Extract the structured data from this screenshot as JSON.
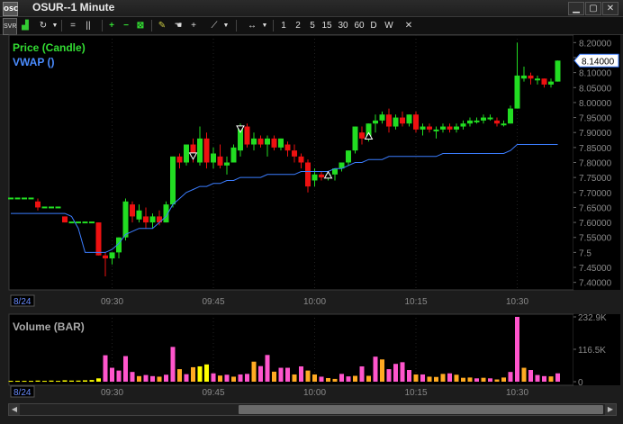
{
  "window": {
    "title": "OSUR--1 Minute",
    "app_icon_text": "OSC",
    "buttons": [
      "minimize-icon",
      "maximize-icon",
      "close-icon"
    ]
  },
  "toolbar": {
    "items": [
      "SVR",
      "chart-icon",
      "refresh-icon",
      "lines-icon",
      "pause-icon",
      "zoom-in-icon",
      "zoom-out-icon",
      "fit-icon",
      "draw-icon",
      "hand-icon",
      "crosshair-icon",
      "trendline-icon",
      "arrows-icon"
    ],
    "intervals": [
      "1",
      "2",
      "5",
      "15",
      "30",
      "60",
      "D",
      "W"
    ],
    "close_label": "✕"
  },
  "colors": {
    "up": "#22dd22",
    "down": "#ee1111",
    "vwap": "#3b7dff",
    "volume_pink": "#ff55cc",
    "volume_orange": "#ffaa22",
    "volume_yellow": "#ffff00",
    "grid": "#3a3a3a",
    "axis_text": "#8a8a8a"
  },
  "chart_data": [
    {
      "type": "candlestick",
      "title": "OSUR--1 Minute",
      "legend": [
        "Price (Candle)",
        "VWAP ()"
      ],
      "ylim": [
        7.375,
        8.225
      ],
      "y_ticks": [
        "8.20000",
        "8.15000",
        "8.10000",
        "8.05000",
        "8.00000",
        "7.95000",
        "7.90000",
        "7.85000",
        "7.80000",
        "7.75000",
        "7.70000",
        "7.65000",
        "7.60000",
        "7.55000",
        "7.5",
        "7.45000",
        "7.40000"
      ],
      "x_ticks": [
        "09:30",
        "09:45",
        "10:00",
        "10:15",
        "10:30"
      ],
      "date_label": "8/24",
      "last_price_label": "8.14000",
      "ohlc": [
        [
          7.68,
          7.68,
          7.67,
          7.68
        ],
        [
          7.68,
          7.68,
          7.67,
          7.68
        ],
        [
          7.68,
          7.68,
          7.67,
          7.68
        ],
        [
          7.68,
          7.68,
          7.67,
          7.68
        ],
        [
          7.67,
          7.68,
          7.64,
          7.65
        ],
        [
          7.65,
          7.66,
          7.64,
          7.65
        ],
        [
          7.65,
          7.65,
          7.64,
          7.65
        ],
        [
          7.65,
          7.65,
          7.64,
          7.65
        ],
        [
          7.62,
          7.62,
          7.6,
          7.6
        ],
        [
          7.6,
          7.62,
          7.59,
          7.6
        ],
        [
          7.6,
          7.6,
          7.59,
          7.6
        ],
        [
          7.6,
          7.61,
          7.59,
          7.6
        ],
        [
          7.6,
          7.6,
          7.59,
          7.6
        ],
        [
          7.6,
          7.6,
          7.49,
          7.49
        ],
        [
          7.49,
          7.5,
          7.42,
          7.48
        ],
        [
          7.48,
          7.5,
          7.46,
          7.5
        ],
        [
          7.5,
          7.55,
          7.48,
          7.55
        ],
        [
          7.55,
          7.68,
          7.54,
          7.67
        ],
        [
          7.66,
          7.67,
          7.6,
          7.62
        ],
        [
          7.61,
          7.66,
          7.6,
          7.64
        ],
        [
          7.62,
          7.65,
          7.58,
          7.6
        ],
        [
          7.6,
          7.63,
          7.58,
          7.62
        ],
        [
          7.62,
          7.64,
          7.59,
          7.6
        ],
        [
          7.6,
          7.67,
          7.6,
          7.66
        ],
        [
          7.66,
          7.82,
          7.65,
          7.82
        ],
        [
          7.82,
          7.83,
          7.78,
          7.8
        ],
        [
          7.8,
          7.86,
          7.79,
          7.86
        ],
        [
          7.86,
          7.88,
          7.8,
          7.82
        ],
        [
          7.8,
          7.92,
          7.79,
          7.88
        ],
        [
          7.88,
          7.9,
          7.78,
          7.8
        ],
        [
          7.8,
          7.85,
          7.78,
          7.83
        ],
        [
          7.82,
          7.86,
          7.78,
          7.79
        ],
        [
          7.79,
          7.82,
          7.76,
          7.8
        ],
        [
          7.8,
          7.86,
          7.8,
          7.85
        ],
        [
          7.84,
          7.93,
          7.82,
          7.92
        ],
        [
          7.92,
          7.93,
          7.85,
          7.86
        ],
        [
          7.86,
          7.9,
          7.84,
          7.88
        ],
        [
          7.88,
          7.89,
          7.85,
          7.86
        ],
        [
          7.86,
          7.89,
          7.82,
          7.88
        ],
        [
          7.88,
          7.89,
          7.84,
          7.85
        ],
        [
          7.85,
          7.88,
          7.84,
          7.88
        ],
        [
          7.86,
          7.87,
          7.82,
          7.84
        ],
        [
          7.84,
          7.86,
          7.8,
          7.82
        ],
        [
          7.82,
          7.83,
          7.78,
          7.8
        ],
        [
          7.8,
          7.81,
          7.7,
          7.72
        ],
        [
          7.74,
          7.78,
          7.72,
          7.76
        ],
        [
          7.76,
          7.77,
          7.74,
          7.75
        ],
        [
          7.75,
          7.77,
          7.74,
          7.76
        ],
        [
          7.76,
          7.78,
          7.74,
          7.78
        ],
        [
          7.78,
          7.8,
          7.77,
          7.8
        ],
        [
          7.8,
          7.84,
          7.79,
          7.84
        ],
        [
          7.84,
          7.92,
          7.83,
          7.92
        ],
        [
          7.9,
          7.92,
          7.86,
          7.88
        ],
        [
          7.88,
          7.93,
          7.87,
          7.93
        ],
        [
          7.93,
          7.96,
          7.9,
          7.94
        ],
        [
          7.94,
          7.97,
          7.93,
          7.96
        ],
        [
          7.96,
          7.98,
          7.9,
          7.92
        ],
        [
          7.92,
          7.96,
          7.91,
          7.95
        ],
        [
          7.95,
          7.97,
          7.92,
          7.93
        ],
        [
          7.93,
          7.96,
          7.92,
          7.96
        ],
        [
          7.96,
          7.97,
          7.9,
          7.91
        ],
        [
          7.91,
          7.93,
          7.89,
          7.92
        ],
        [
          7.92,
          7.93,
          7.9,
          7.91
        ],
        [
          7.91,
          7.92,
          7.88,
          7.91
        ],
        [
          7.91,
          7.93,
          7.9,
          7.92
        ],
        [
          7.92,
          7.93,
          7.9,
          7.91
        ],
        [
          7.91,
          7.93,
          7.9,
          7.92
        ],
        [
          7.92,
          7.94,
          7.91,
          7.93
        ],
        [
          7.93,
          7.95,
          7.92,
          7.94
        ],
        [
          7.94,
          7.95,
          7.93,
          7.94
        ],
        [
          7.94,
          7.96,
          7.93,
          7.95
        ],
        [
          7.95,
          7.96,
          7.94,
          7.95
        ],
        [
          7.94,
          7.95,
          7.92,
          7.93
        ],
        [
          7.93,
          7.94,
          7.92,
          7.93
        ],
        [
          7.93,
          7.99,
          7.93,
          7.98
        ],
        [
          7.98,
          8.2,
          7.98,
          8.09
        ],
        [
          8.08,
          8.12,
          8.07,
          8.09
        ],
        [
          8.09,
          8.1,
          8.06,
          8.08
        ],
        [
          8.08,
          8.09,
          8.06,
          8.08
        ],
        [
          8.08,
          8.08,
          8.05,
          8.06
        ],
        [
          8.06,
          8.08,
          8.05,
          8.07
        ],
        [
          8.07,
          8.14,
          8.07,
          8.14
        ]
      ],
      "vwap": [
        7.63,
        7.63,
        7.63,
        7.63,
        7.63,
        7.63,
        7.63,
        7.63,
        7.63,
        7.62,
        7.58,
        7.5,
        7.5,
        7.5,
        7.5,
        7.51,
        7.53,
        7.56,
        7.57,
        7.58,
        7.58,
        7.58,
        7.6,
        7.62,
        7.66,
        7.68,
        7.7,
        7.71,
        7.72,
        7.72,
        7.73,
        7.73,
        7.74,
        7.74,
        7.75,
        7.75,
        7.75,
        7.75,
        7.76,
        7.76,
        7.76,
        7.76,
        7.76,
        7.77,
        7.77,
        7.77,
        7.77,
        7.77,
        7.78,
        7.78,
        7.79,
        7.8,
        7.8,
        7.81,
        7.81,
        7.81,
        7.82,
        7.82,
        7.82,
        7.82,
        7.82,
        7.82,
        7.82,
        7.82,
        7.83,
        7.83,
        7.83,
        7.83,
        7.83,
        7.83,
        7.83,
        7.83,
        7.83,
        7.83,
        7.84,
        7.86,
        7.86,
        7.86,
        7.86,
        7.86,
        7.86,
        7.86
      ],
      "signals_down": [
        [
          27,
          7.82
        ],
        [
          34,
          7.91
        ]
      ],
      "signals_up": [
        [
          47,
          7.76
        ],
        [
          53,
          7.89
        ]
      ]
    },
    {
      "type": "bar",
      "title": "Volume (BAR)",
      "ylim": [
        0,
        232900
      ],
      "y_ticks": [
        "232.9K",
        "116.5K",
        "0"
      ],
      "values": [
        3000,
        3000,
        3000,
        3000,
        4000,
        3000,
        4000,
        3000,
        5000,
        4000,
        4000,
        5000,
        6000,
        12000,
        95000,
        50000,
        40000,
        92000,
        35000,
        20000,
        24000,
        20000,
        18000,
        25000,
        125000,
        45000,
        27000,
        52000,
        55000,
        62000,
        30000,
        22000,
        25000,
        18000,
        26000,
        28000,
        72000,
        56000,
        96000,
        36000,
        50000,
        50000,
        26000,
        55000,
        40000,
        26000,
        18000,
        13000,
        10000,
        28000,
        19000,
        21000,
        55000,
        21000,
        90000,
        80000,
        45000,
        64000,
        70000,
        42000,
        26000,
        26000,
        18000,
        17000,
        28000,
        30000,
        25000,
        14000,
        15000,
        12000,
        14000,
        12000,
        8000,
        15000,
        35000,
        232900,
        50000,
        42000,
        24000,
        20000,
        19000,
        30000
      ],
      "colors": [
        "y",
        "y",
        "y",
        "y",
        "y",
        "y",
        "y",
        "y",
        "y",
        "y",
        "y",
        "y",
        "y",
        "y",
        "p",
        "p",
        "p",
        "p",
        "p",
        "o",
        "p",
        "p",
        "o",
        "p",
        "p",
        "o",
        "p",
        "o",
        "y",
        "y",
        "p",
        "o",
        "p",
        "o",
        "p",
        "p",
        "o",
        "p",
        "p",
        "o",
        "p",
        "p",
        "o",
        "p",
        "o",
        "o",
        "p",
        "o",
        "o",
        "p",
        "p",
        "o",
        "p",
        "o",
        "p",
        "o",
        "p",
        "p",
        "p",
        "p",
        "o",
        "p",
        "o",
        "o",
        "o",
        "p",
        "o",
        "o",
        "o",
        "p",
        "o",
        "p",
        "o",
        "o",
        "p",
        "p",
        "o",
        "p",
        "p",
        "p",
        "o",
        "p"
      ]
    }
  ],
  "scrollbar": {
    "left": "◀",
    "right": "▶"
  }
}
